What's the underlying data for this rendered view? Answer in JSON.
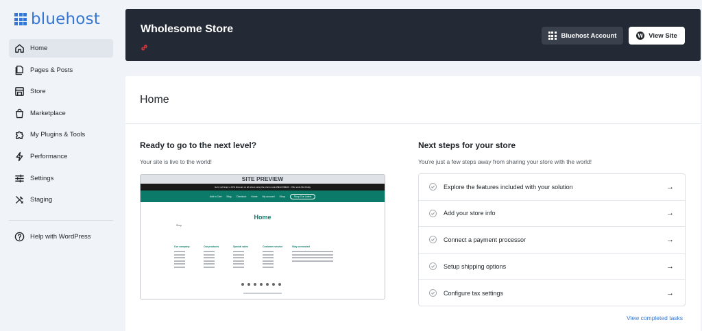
{
  "brand": {
    "name": "bluehost",
    "color": "#3575d3"
  },
  "sidebar": {
    "items": [
      {
        "label": "Home",
        "icon": "home-icon",
        "active": true
      },
      {
        "label": "Pages & Posts",
        "icon": "pages-icon"
      },
      {
        "label": "Store",
        "icon": "store-icon"
      },
      {
        "label": "Marketplace",
        "icon": "bag-icon"
      },
      {
        "label": "My Plugins & Tools",
        "icon": "puzzle-icon"
      },
      {
        "label": "Performance",
        "icon": "bolt-icon"
      },
      {
        "label": "Settings",
        "icon": "sliders-icon"
      },
      {
        "label": "Staging",
        "icon": "tools-icon"
      }
    ],
    "help": {
      "label": "Help with WordPress",
      "icon": "question-icon"
    }
  },
  "header": {
    "store_title": "Wholesome Store",
    "account_button": "Bluehost Account",
    "view_site_button": "View Site",
    "bg_color": "#232a36"
  },
  "main": {
    "page_title": "Home",
    "left": {
      "title": "Ready to go to the next level?",
      "subtitle": "Your site is live to the world!",
      "preview_label": "SITE PREVIEW",
      "preview": {
        "banner": "Hurry up! Enjoy a 10% discount on all orders using the promo code WELCOME10 · Offer ends this Friday",
        "nav": [
          "Add to Cart",
          "Blog",
          "Checkout",
          "Home",
          "My account",
          "Shop"
        ],
        "nav_button": "Shop Our Latest",
        "home_heading": "Home",
        "shop_label": "Shop",
        "columns": [
          "Our company",
          "Our products",
          "Special sales",
          "Customer service",
          "Stay connected"
        ],
        "accent": "#0b7a68"
      }
    },
    "right": {
      "title": "Next steps for your store",
      "subtitle": "You're just a few steps away from sharing your store with the world!",
      "steps": [
        "Explore the features included with your solution",
        "Add your store info",
        "Connect a payment processor",
        "Setup shipping options",
        "Configure tax settings"
      ],
      "view_completed": "View completed tasks"
    }
  }
}
